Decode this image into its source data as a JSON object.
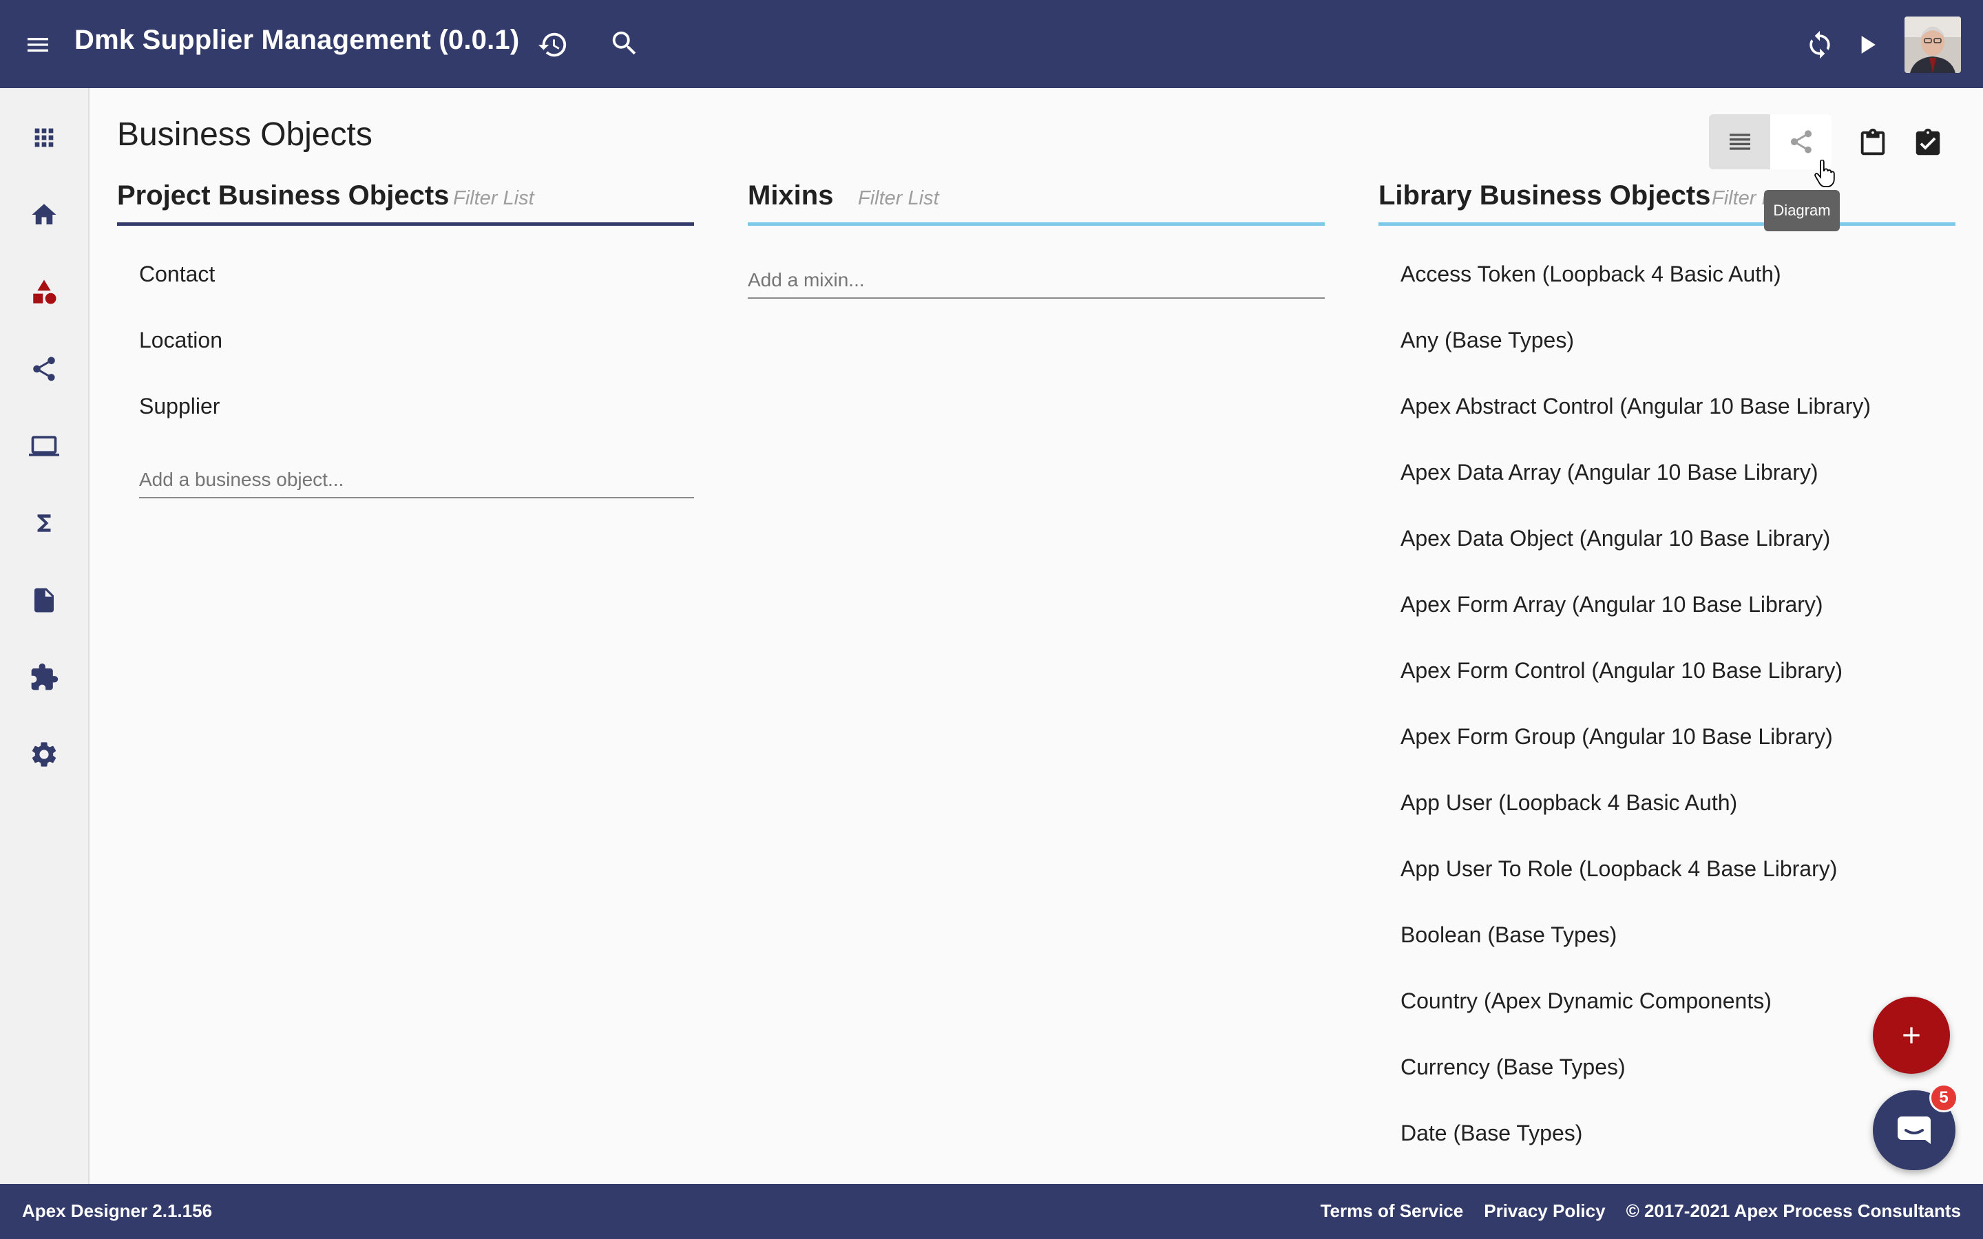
{
  "header": {
    "title": "Dmk Supplier Management (0.0.1)",
    "icons": {
      "menu": "menu-icon",
      "history": "history-icon",
      "search": "search-icon",
      "refresh": "refresh-icon",
      "play": "play-icon"
    }
  },
  "nav": {
    "items": [
      {
        "name": "apps",
        "icon": "grid-icon"
      },
      {
        "name": "home",
        "icon": "home-icon"
      },
      {
        "name": "business-objects",
        "icon": "shapes-icon",
        "active": true
      },
      {
        "name": "relationships",
        "icon": "share-icon"
      },
      {
        "name": "user-interfaces",
        "icon": "laptop-icon"
      },
      {
        "name": "functions",
        "icon": "sigma-icon"
      },
      {
        "name": "files",
        "icon": "file-icon"
      },
      {
        "name": "libraries",
        "icon": "puzzle-icon"
      },
      {
        "name": "settings",
        "icon": "gear-icon"
      }
    ]
  },
  "page": {
    "title": "Business Objects",
    "tooltip": "Diagram"
  },
  "columns": {
    "project": {
      "title": "Project Business Objects",
      "filter_placeholder": "Filter List",
      "items": [
        "Contact",
        "Location",
        "Supplier"
      ],
      "add_placeholder": "Add a business object..."
    },
    "mixins": {
      "title": "Mixins",
      "filter_placeholder": "Filter List",
      "add_placeholder": "Add a mixin..."
    },
    "library": {
      "title": "Library Business Objects",
      "filter_placeholder": "Filter L",
      "items": [
        "Access Token (Loopback 4 Basic Auth)",
        "Any (Base Types)",
        "Apex Abstract Control (Angular 10 Base Library)",
        "Apex Data Array (Angular 10 Base Library)",
        "Apex Data Object (Angular 10 Base Library)",
        "Apex Form Array (Angular 10 Base Library)",
        "Apex Form Control (Angular 10 Base Library)",
        "Apex Form Group (Angular 10 Base Library)",
        "App User (Loopback 4 Basic Auth)",
        "App User To Role (Loopback 4 Base Library)",
        "Boolean (Base Types)",
        "Country (Apex Dynamic Components)",
        "Currency (Base Types)",
        "Date (Base Types)"
      ]
    }
  },
  "chat": {
    "badge": "5"
  },
  "footer": {
    "version": "Apex Designer 2.1.156",
    "terms": "Terms of Service",
    "privacy": "Privacy Policy",
    "copyright": "© 2017-2021 Apex Process Consultants"
  },
  "colors": {
    "primary": "#333b6a",
    "accent_fab": "#a80f12",
    "active_nav_icon": "#a80f12",
    "tab_underline": "#7ec8ea"
  }
}
